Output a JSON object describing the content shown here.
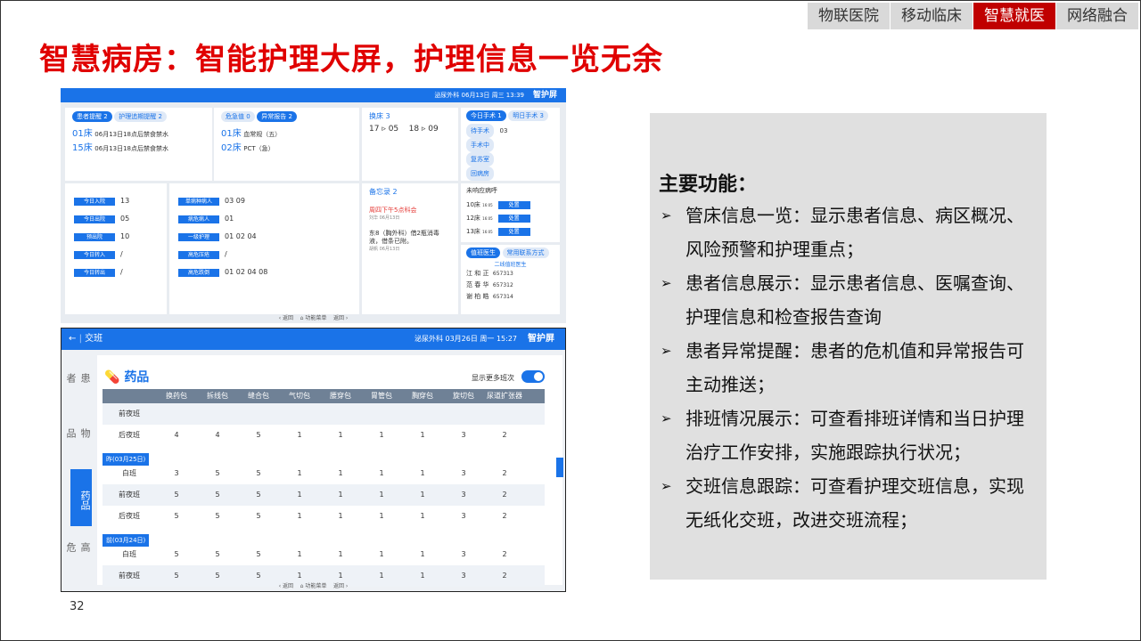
{
  "nav_tabs": [
    {
      "label": "物联医院",
      "active": false
    },
    {
      "label": "移动临床",
      "active": false
    },
    {
      "label": "智慧就医",
      "active": true
    },
    {
      "label": "网络融合",
      "active": false
    }
  ],
  "title": "智慧病房：智能护理大屏，护理信息一览无余",
  "page_number": "32",
  "screen1": {
    "header": "泌尿外科 06月13日 周三 13:39",
    "brand": "智护屏",
    "reminder_tabs": [
      "患者提醒 2",
      "护理追期提醒 2"
    ],
    "reminders": [
      {
        "bed": "01床",
        "text": "06月13日18点后禁食禁水"
      },
      {
        "bed": "15床",
        "text": "06月13日18点后禁食禁水"
      }
    ],
    "alert_tabs": [
      "危急值 0",
      "异常报告 2"
    ],
    "alerts": [
      {
        "bed": "01床",
        "text": "血常规（五）"
      },
      {
        "bed": "02床",
        "text": "PCT（急）"
      }
    ],
    "bed_change": {
      "title": "换床 3",
      "moves": [
        "17 ▹ 05",
        "18 ▹ 09"
      ]
    },
    "surgery_tabs": [
      "今日手术 1",
      "明日手术 3"
    ],
    "surgery_items": [
      {
        "label": "待手术",
        "value": "03"
      },
      {
        "label": "手术中",
        "value": ""
      },
      {
        "label": "复苏室",
        "value": ""
      },
      {
        "label": "回病房",
        "value": ""
      }
    ],
    "stats_left": [
      {
        "label": "今日入院",
        "value": "13"
      },
      {
        "label": "今日出院",
        "value": "05"
      },
      {
        "label": "预出院",
        "value": "10"
      },
      {
        "label": "今日转入",
        "value": "/"
      },
      {
        "label": "今日转出",
        "value": "/"
      }
    ],
    "stats_right": [
      {
        "label": "单病种病人",
        "value": "03  09"
      },
      {
        "label": "病危病人",
        "value": "01"
      },
      {
        "label": "一级护理",
        "value": "01  02  04"
      },
      {
        "label": "高危压疮",
        "value": "/"
      },
      {
        "label": "高危跌倒",
        "value": "01  02  04  08"
      }
    ],
    "memo": {
      "title": "备忘录 2",
      "item1": "周四下午5点科会",
      "item1_by": "刘华 06月13日",
      "item2": "东8（胸外科）借2瓶消毒液，借条已附。",
      "item2_by": "胡帆 06月13日"
    },
    "calls": {
      "title": "未响应病呼",
      "items": [
        {
          "bed": "10床",
          "time": "16:05",
          "btn": "处置"
        },
        {
          "bed": "12床",
          "time": "16:05",
          "btn": "处置"
        },
        {
          "bed": "13床",
          "time": "16:05",
          "btn": "处置"
        }
      ]
    },
    "duty": {
      "tabs": [
        "值班医生",
        "常用联系方式"
      ],
      "subtitle": "二线值班医生",
      "doctors": [
        {
          "name": "江 和 正",
          "phone": "657313"
        },
        {
          "name": "范 春 华",
          "phone": "657312"
        },
        {
          "name": "谢 柏 皓",
          "phone": "657314"
        }
      ]
    },
    "footer": [
      "‹ 返回",
      "⌂ 功能菜单",
      "返回 ›"
    ]
  },
  "screen2": {
    "back": "← ",
    "title": "交班",
    "header": "泌尿外科 03月26日 周一 15:27",
    "brand": "智护屏",
    "side_tabs": [
      {
        "label": "患者",
        "active": false
      },
      {
        "label": "物品",
        "active": false
      },
      {
        "label": "药品",
        "active": true
      },
      {
        "label": "高危药",
        "active": false
      }
    ],
    "panel_title": "药品",
    "toggle_label": "显示更多班次",
    "columns": [
      "",
      "换药包",
      "拆线包",
      "缝合包",
      "气切包",
      "腰穿包",
      "胃管包",
      "胸穿包",
      "旋切包",
      "尿道扩张器"
    ],
    "rows": [
      {
        "type": "row",
        "cells": [
          "前夜班",
          "",
          "",
          "",
          "",
          "",
          "",
          "",
          "",
          ""
        ],
        "alt": true
      },
      {
        "type": "row",
        "cells": [
          "后夜班",
          "4",
          "4",
          "5",
          "1",
          "1",
          "1",
          "1",
          "3",
          "2"
        ],
        "alt": false
      },
      {
        "type": "date",
        "label": "昨(03月25日)"
      },
      {
        "type": "row",
        "cells": [
          "白班",
          "3",
          "5",
          "5",
          "1",
          "1",
          "1",
          "1",
          "3",
          "2"
        ],
        "alt": false
      },
      {
        "type": "row",
        "cells": [
          "前夜班",
          "5",
          "5",
          "5",
          "1",
          "1",
          "1",
          "1",
          "3",
          "2"
        ],
        "alt": true
      },
      {
        "type": "row",
        "cells": [
          "后夜班",
          "5",
          "5",
          "5",
          "1",
          "1",
          "1",
          "1",
          "3",
          "2"
        ],
        "alt": false
      },
      {
        "type": "date",
        "label": "前(03月24日)"
      },
      {
        "type": "row",
        "cells": [
          "白班",
          "5",
          "5",
          "5",
          "1",
          "1",
          "1",
          "1",
          "3",
          "2"
        ],
        "alt": false
      },
      {
        "type": "row",
        "cells": [
          "前夜班",
          "5",
          "5",
          "5",
          "1",
          "1",
          "1",
          "1",
          "3",
          "2"
        ],
        "alt": true
      },
      {
        "type": "row",
        "cells": [
          "后夜班",
          "5",
          "5",
          "5",
          "1",
          "1",
          "1",
          "1",
          "3",
          "2"
        ],
        "alt": false
      }
    ],
    "footer": [
      "‹ 返回",
      "⌂ 功能菜单",
      "返回 ›"
    ]
  },
  "features": {
    "title": "主要功能：",
    "items": [
      "管床信息一览：显示患者信息、病区概况、风险预警和护理重点；",
      "患者信息展示：显示患者信息、医嘱查询、护理信息和检查报告查询",
      "患者异常提醒：患者的危机值和异常报告可主动推送；",
      "排班情况展示：可查看排班详情和当日护理治疗工作安排，实施跟踪执行状况；",
      "交班信息跟踪：可查看护理交班信息，实现无纸化交班，改进交班流程；"
    ]
  }
}
